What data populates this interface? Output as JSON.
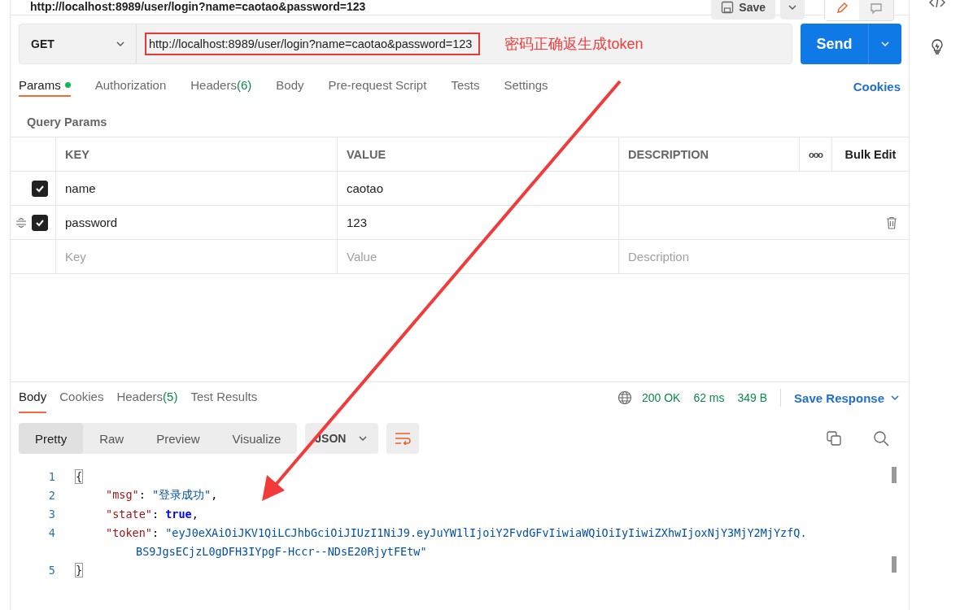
{
  "title": "http://localhost:8989/user/login?name=caotao&password=123",
  "save_button": "Save",
  "request": {
    "method": "GET",
    "url": "http://localhost:8989/user/login?name=caotao&password=123",
    "send_button": "Send"
  },
  "annotation": {
    "note": "密码正确返生成token"
  },
  "request_tabs": [
    {
      "label": "Params",
      "selected": true,
      "dot": true
    },
    {
      "label": "Authorization",
      "selected": false
    },
    {
      "label": "Headers",
      "count": "(6)",
      "selected": false
    },
    {
      "label": "Body",
      "selected": false
    },
    {
      "label": "Pre-request Script",
      "selected": false
    },
    {
      "label": "Tests",
      "selected": false
    },
    {
      "label": "Settings",
      "selected": false
    }
  ],
  "cookies_link": "Cookies",
  "section_title": "Query Params",
  "params_table": {
    "columns": [
      "KEY",
      "VALUE",
      "DESCRIPTION"
    ],
    "more_button": "ooo",
    "bulk_edit": "Bulk Edit",
    "rows": [
      {
        "key": "name",
        "value": "caotao",
        "checked": true,
        "hovered": false
      },
      {
        "key": "password",
        "value": "123",
        "checked": true,
        "hovered": true
      }
    ],
    "empty_row": [
      {
        "placeholder": "Key"
      },
      {
        "placeholder": "Value"
      },
      {
        "placeholder": "Description"
      }
    ]
  },
  "response_tabs": [
    {
      "label": "Body",
      "selected": true
    },
    {
      "label": "Cookies",
      "selected": false
    },
    {
      "label": "Headers",
      "count": "(5)",
      "selected": false
    },
    {
      "label": "Test Results",
      "selected": false
    }
  ],
  "response_status": {
    "status": "200 OK",
    "time": "62 ms",
    "size": "349 B",
    "save_response": "Save Response"
  },
  "view_modes": [
    {
      "label": "Pretty",
      "selected": true
    },
    {
      "label": "Raw",
      "selected": false
    },
    {
      "label": "Preview",
      "selected": false
    },
    {
      "label": "Visualize",
      "selected": false
    }
  ],
  "format": "JSON",
  "code_lines": [
    {
      "number": "1",
      "segments": [
        {
          "kind": "brace",
          "text": "{"
        }
      ]
    },
    {
      "number": "2",
      "segments": [
        {
          "kind": "key",
          "text": "\"msg\""
        },
        {
          "kind": "punct",
          "text": ": "
        },
        {
          "kind": "string",
          "text": "\"登录成功\""
        },
        {
          "kind": "punct",
          "text": ","
        }
      ]
    },
    {
      "number": "3",
      "segments": [
        {
          "kind": "key",
          "text": "\"state\""
        },
        {
          "kind": "punct",
          "text": ": "
        },
        {
          "kind": "bool",
          "text": "true"
        },
        {
          "kind": "punct",
          "text": ","
        }
      ]
    },
    {
      "number": "4",
      "segments": [
        {
          "kind": "key",
          "text": "\"token\""
        },
        {
          "kind": "punct",
          "text": ": "
        },
        {
          "kind": "string",
          "text": "\"eyJ0eXAiOiJKV1QiLCJhbGciOiJIUzI1NiJ9.eyJuYW1lIjoiY2FvdGFvIiwiaWQiOiIyIiwiZXhwIjoxNjY3MjY2MjYzfQ."
        }
      ]
    },
    {
      "segments": [
        {
          "kind": "string",
          "text": "BS9JgsECjzL0gDFH3IYpgF-Hccr--NDsE20RjytFEtw\""
        }
      ]
    },
    {
      "number": "5",
      "segments": [
        {
          "kind": "brace",
          "text": "}"
        }
      ]
    }
  ]
}
